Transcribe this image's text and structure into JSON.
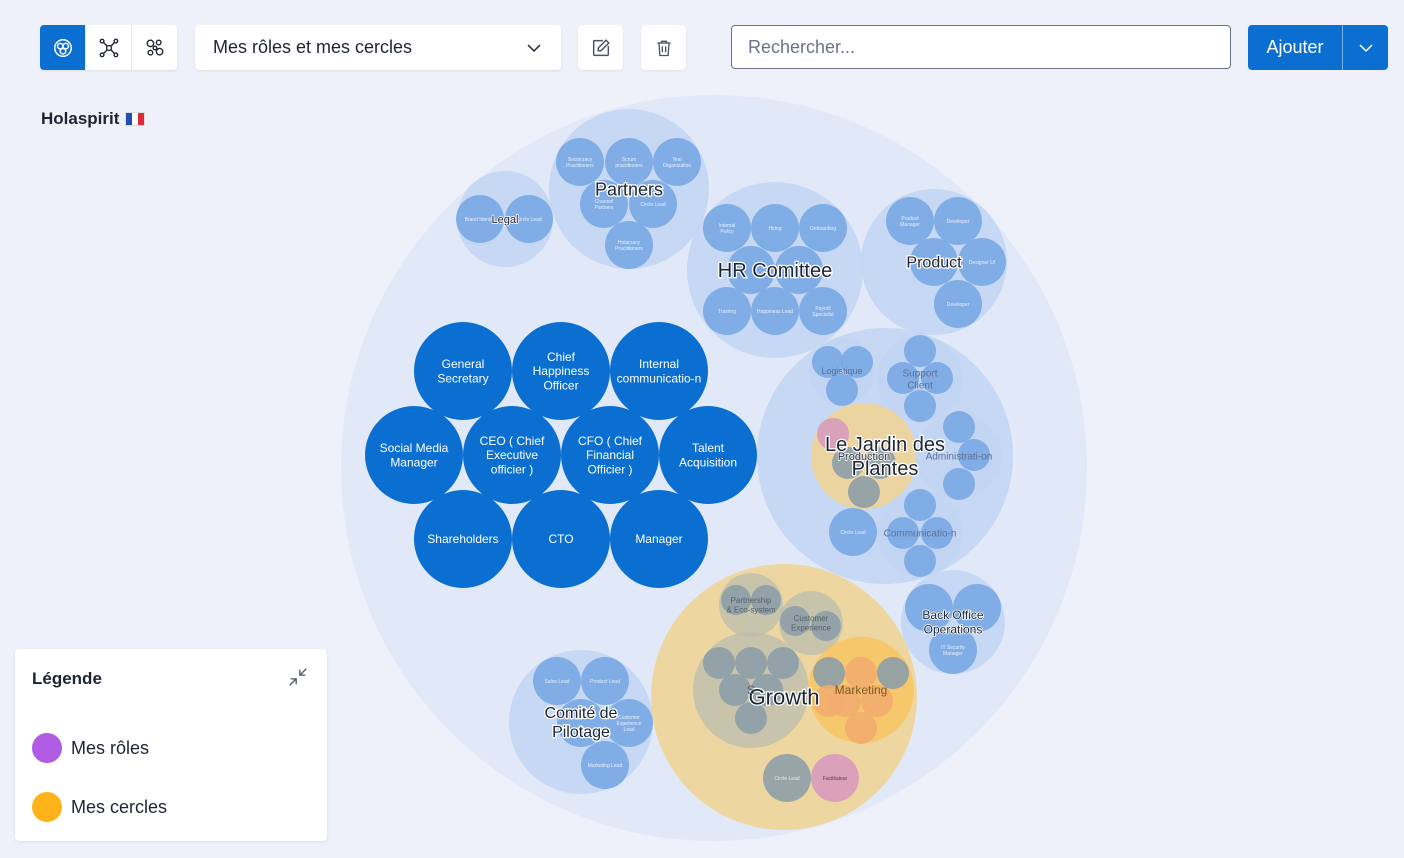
{
  "toolbar": {
    "view_modes": [
      {
        "name": "bubble-view-icon",
        "active": true
      },
      {
        "name": "network-view-icon",
        "active": false
      },
      {
        "name": "cluster-view-icon",
        "active": false
      }
    ],
    "selector_value": "Mes rôles et mes cercles",
    "search_placeholder": "Rechercher...",
    "add_label": "Ajouter"
  },
  "org": {
    "name": "Holaspirit"
  },
  "legend": {
    "title": "Légende",
    "items": [
      {
        "label": "Mes rôles",
        "color": "#b15be4"
      },
      {
        "label": "Mes cercles",
        "color": "#ffb31a"
      }
    ]
  },
  "colors": {
    "accent": "#0b6fd1",
    "role": "#0b6fd1",
    "circle_bg": "#dce6f8",
    "sub_circle": "#c1d5f2",
    "sub_role": "#79a9e4",
    "my_circle": "#f0d497",
    "my_circle_strong": "#f7c461"
  },
  "bubbles": [
    {
      "key": "root",
      "label": "",
      "kind": "root"
    },
    {
      "key": "legal",
      "label": "Legal",
      "kind": "circle"
    },
    {
      "key": "legal-r1",
      "label": "Brand Identity",
      "kind": "subrole",
      "parent": "legal"
    },
    {
      "key": "legal-r2",
      "label": "Circle Lead",
      "kind": "subrole",
      "parent": "legal"
    },
    {
      "key": "partners",
      "label": "Partners",
      "kind": "circle"
    },
    {
      "key": "partners-r1",
      "label": "Sociocracy Practitioners",
      "kind": "subrole",
      "parent": "partners"
    },
    {
      "key": "partners-r2",
      "label": "Scrum practitioners",
      "kind": "subrole",
      "parent": "partners"
    },
    {
      "key": "partners-r3",
      "label": "Teal Organization",
      "kind": "subrole",
      "parent": "partners"
    },
    {
      "key": "partners-r4",
      "label": "Channel Partners",
      "kind": "subrole",
      "parent": "partners"
    },
    {
      "key": "partners-r5",
      "label": "Circle Lead",
      "kind": "subrole",
      "parent": "partners"
    },
    {
      "key": "partners-r6",
      "label": "Holacracy Practitioners",
      "kind": "subrole",
      "parent": "partners"
    },
    {
      "key": "hr",
      "label": "HR Comittee",
      "kind": "circle"
    },
    {
      "key": "hr-r1",
      "label": "Internal Policy",
      "kind": "subrole",
      "parent": "hr"
    },
    {
      "key": "hr-r2",
      "label": "Hiring",
      "kind": "subrole",
      "parent": "hr"
    },
    {
      "key": "hr-r3",
      "label": "Onboarding",
      "kind": "subrole",
      "parent": "hr"
    },
    {
      "key": "hr-r4",
      "label": "",
      "kind": "subrole",
      "parent": "hr"
    },
    {
      "key": "hr-r5",
      "label": "",
      "kind": "subrole",
      "parent": "hr"
    },
    {
      "key": "hr-r6",
      "label": "Training",
      "kind": "subrole",
      "parent": "hr"
    },
    {
      "key": "hr-r7",
      "label": "Happiness Lead",
      "kind": "subrole",
      "parent": "hr"
    },
    {
      "key": "hr-r8",
      "label": "Payroll Specialist",
      "kind": "subrole",
      "parent": "hr"
    },
    {
      "key": "product",
      "label": "Product",
      "kind": "circle"
    },
    {
      "key": "product-r1",
      "label": "Product Manager",
      "kind": "subrole",
      "parent": "product"
    },
    {
      "key": "product-r2",
      "label": "Developer",
      "kind": "subrole",
      "parent": "product"
    },
    {
      "key": "product-r3",
      "label": "",
      "kind": "subrole",
      "parent": "product"
    },
    {
      "key": "product-r4",
      "label": "Designer UI",
      "kind": "subrole",
      "parent": "product"
    },
    {
      "key": "product-r5",
      "label": "Developer",
      "kind": "subrole",
      "parent": "product"
    },
    {
      "key": "role-1",
      "label": "General Secretary",
      "kind": "role"
    },
    {
      "key": "role-2",
      "label": "Chief Happiness Officer",
      "kind": "role"
    },
    {
      "key": "role-3",
      "label": "Internal communicatio-n",
      "kind": "role"
    },
    {
      "key": "role-4",
      "label": "Social Media Manager",
      "kind": "role"
    },
    {
      "key": "role-5",
      "label": "CEO ( Chief Executive officier )",
      "kind": "role"
    },
    {
      "key": "role-6",
      "label": "CFO ( Chief Financial Officier )",
      "kind": "role"
    },
    {
      "key": "role-7",
      "label": "Talent Acquisition",
      "kind": "role"
    },
    {
      "key": "role-8",
      "label": "Shareholders",
      "kind": "role"
    },
    {
      "key": "role-9",
      "label": "CTO",
      "kind": "role"
    },
    {
      "key": "role-10",
      "label": "Manager",
      "kind": "role"
    },
    {
      "key": "jardin",
      "label": "Le Jardin des Plantes",
      "kind": "circle"
    },
    {
      "key": "logistique",
      "label": "Logistique",
      "kind": "subcircle",
      "parent": "jardin"
    },
    {
      "key": "log-r1",
      "label": "",
      "kind": "subrole",
      "parent": "logistique"
    },
    {
      "key": "log-r2",
      "label": "",
      "kind": "subrole",
      "parent": "logistique"
    },
    {
      "key": "log-r3",
      "label": "",
      "kind": "subrole",
      "parent": "logistique"
    },
    {
      "key": "support",
      "label": "Support Client",
      "kind": "subcircle",
      "parent": "jardin"
    },
    {
      "key": "sup-r1",
      "label": "",
      "kind": "subrole",
      "parent": "support"
    },
    {
      "key": "sup-r2",
      "label": "",
      "kind": "subrole",
      "parent": "support"
    },
    {
      "key": "sup-r3",
      "label": "",
      "kind": "subrole",
      "parent": "support"
    },
    {
      "key": "sup-r4",
      "label": "",
      "kind": "subrole",
      "parent": "support"
    },
    {
      "key": "production",
      "label": "Production",
      "kind": "mycircle",
      "parent": "jardin"
    },
    {
      "key": "prod-r1",
      "label": "",
      "kind": "pinkrole",
      "parent": "production"
    },
    {
      "key": "prod-r2",
      "label": "",
      "kind": "greyrole",
      "parent": "production"
    },
    {
      "key": "prod-r3",
      "label": "",
      "kind": "greyrole",
      "parent": "production"
    },
    {
      "key": "prod-r4",
      "label": "",
      "kind": "greyrole",
      "parent": "production"
    },
    {
      "key": "admin",
      "label": "Administrati-on",
      "kind": "subcircle",
      "parent": "jardin"
    },
    {
      "key": "adm-r1",
      "label": "",
      "kind": "subrole",
      "parent": "admin"
    },
    {
      "key": "adm-r2",
      "label": "",
      "kind": "subrole",
      "parent": "admin"
    },
    {
      "key": "adm-r3",
      "label": "",
      "kind": "subrole",
      "parent": "admin"
    },
    {
      "key": "jardin-r1",
      "label": "Circle Lead",
      "kind": "subrole",
      "parent": "jardin"
    },
    {
      "key": "comm",
      "label": "Communicatio-n",
      "kind": "subcircle",
      "parent": "jardin"
    },
    {
      "key": "comm-r1",
      "label": "",
      "kind": "subrole",
      "parent": "comm"
    },
    {
      "key": "comm-r2",
      "label": "",
      "kind": "subrole",
      "parent": "comm"
    },
    {
      "key": "comm-r3",
      "label": "",
      "kind": "subrole",
      "parent": "comm"
    },
    {
      "key": "comm-r4",
      "label": "",
      "kind": "subrole",
      "parent": "comm"
    },
    {
      "key": "backoffice",
      "label": "Back Office Operations",
      "kind": "circle"
    },
    {
      "key": "bo-r1",
      "label": "",
      "kind": "subrole",
      "parent": "backoffice"
    },
    {
      "key": "bo-r2",
      "label": "",
      "kind": "subrole",
      "parent": "backoffice"
    },
    {
      "key": "bo-r3",
      "label": "IT Security Manager",
      "kind": "subrole",
      "parent": "backoffice"
    },
    {
      "key": "comite",
      "label": "Comité de Pilotage",
      "kind": "circle"
    },
    {
      "key": "com-r1",
      "label": "Sales Lead",
      "kind": "subrole",
      "parent": "comite"
    },
    {
      "key": "com-r2",
      "label": "Product Lead",
      "kind": "subrole",
      "parent": "comite"
    },
    {
      "key": "com-r3",
      "label": "Customer Experience Lead",
      "kind": "subrole",
      "parent": "comite"
    },
    {
      "key": "com-r4",
      "label": "",
      "kind": "subrole",
      "parent": "comite"
    },
    {
      "key": "com-r5",
      "label": "Marketing Lead",
      "kind": "subrole",
      "parent": "comite"
    },
    {
      "key": "growth",
      "label": "Growth",
      "kind": "mycircle"
    },
    {
      "key": "partnership",
      "label": "Partnership & Eco-system",
      "kind": "greycircle",
      "parent": "growth"
    },
    {
      "key": "pe-r1",
      "label": "",
      "kind": "greyrole",
      "parent": "partnership"
    },
    {
      "key": "pe-r2",
      "label": "",
      "kind": "greyrole",
      "parent": "partnership"
    },
    {
      "key": "cx",
      "label": "Customer Experience",
      "kind": "greycircle",
      "parent": "growth"
    },
    {
      "key": "cx-r1",
      "label": "",
      "kind": "greyrole",
      "parent": "cx"
    },
    {
      "key": "cx-r2",
      "label": "",
      "kind": "greyrole",
      "parent": "cx"
    },
    {
      "key": "sales",
      "label": "S",
      "kind": "greycircle",
      "parent": "growth"
    },
    {
      "key": "s-r1",
      "label": "",
      "kind": "greyrole",
      "parent": "sales"
    },
    {
      "key": "s-r2",
      "label": "",
      "kind": "greyrole",
      "parent": "sales"
    },
    {
      "key": "s-r3",
      "label": "",
      "kind": "greyrole",
      "parent": "sales"
    },
    {
      "key": "s-r4",
      "label": "",
      "kind": "greyrole",
      "parent": "sales"
    },
    {
      "key": "s-r5",
      "label": "",
      "kind": "greyrole",
      "parent": "sales"
    },
    {
      "key": "s-r6",
      "label": "",
      "kind": "greyrole",
      "parent": "sales"
    },
    {
      "key": "marketing",
      "label": "Marketing",
      "kind": "mycircle-strong",
      "parent": "growth"
    },
    {
      "key": "mk-r1",
      "label": "",
      "kind": "greyrole",
      "parent": "marketing"
    },
    {
      "key": "mk-r2",
      "label": "",
      "kind": "orangerole",
      "parent": "marketing"
    },
    {
      "key": "mk-r3",
      "label": "",
      "kind": "greyrole",
      "parent": "marketing"
    },
    {
      "key": "mk-r4",
      "label": "",
      "kind": "orangerole",
      "parent": "marketing"
    },
    {
      "key": "mk-r5",
      "label": "",
      "kind": "orangerole",
      "parent": "marketing"
    },
    {
      "key": "mk-r6",
      "label": "",
      "kind": "orangerole",
      "parent": "marketing"
    },
    {
      "key": "mk-r7",
      "label": "",
      "kind": "orangerole",
      "parent": "marketing"
    },
    {
      "key": "growth-r1",
      "label": "Circle Lead",
      "kind": "greyrole",
      "parent": "growth"
    },
    {
      "key": "growth-r2",
      "label": "Facilitateur",
      "kind": "pinkrole",
      "parent": "growth"
    }
  ]
}
